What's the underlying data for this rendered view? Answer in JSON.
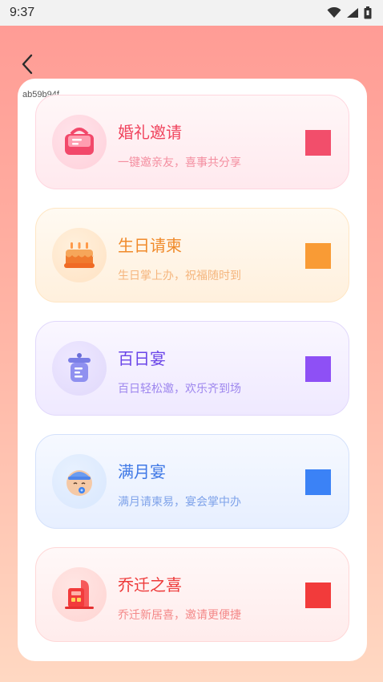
{
  "status_bar": {
    "time": "9:37"
  },
  "watermark": "ab59b94f",
  "items": [
    {
      "title": "婚礼邀请",
      "subtitle": "一键邀亲友，喜事共分享",
      "color": "#f24e6b",
      "icon": "envelope-gift-icon"
    },
    {
      "title": "生日请柬",
      "subtitle": "生日掌上办，祝福随时到",
      "color": "#f99b35",
      "icon": "birthday-cake-icon"
    },
    {
      "title": "百日宴",
      "subtitle": "百日轻松邀，欢乐齐到场",
      "color": "#8e50f5",
      "icon": "baby-bottle-icon"
    },
    {
      "title": "满月宴",
      "subtitle": "满月请柬易，宴会掌中办",
      "color": "#3b82f6",
      "icon": "baby-face-icon"
    },
    {
      "title": "乔迁之喜",
      "subtitle": "乔迁新居喜，邀请更便捷",
      "color": "#f23b3b",
      "icon": "house-icon"
    }
  ]
}
